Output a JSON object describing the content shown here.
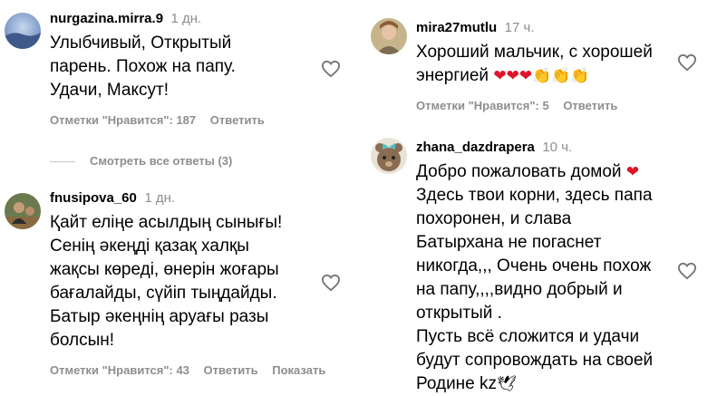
{
  "icons": {
    "like": "heart-outline-icon"
  },
  "left": {
    "c1": {
      "username": "nurgazina.mirra.9",
      "time": "1 дн.",
      "lines": [
        "Улыбчивый, Открытый",
        "парень. Похож на папу.",
        "Удачи, Максут!"
      ],
      "likes": "Отметки \"Нравится\": 187",
      "reply": "Ответить"
    },
    "view_replies": "Смотреть все ответы (3)",
    "c2": {
      "username": "fnusipova_60",
      "time": "1 дн.",
      "lines": [
        "Қайт еліңе асылдың сынығы!",
        "Сенің әкеңді қазақ халқы",
        "жақсы көреді, өнерін жоғары",
        "бағалайды, сүйіп тыңдайды.",
        "Батыр әкеңнің аруағы разы",
        "болсын!"
      ],
      "likes": "Отметки \"Нравится\": 43",
      "reply": "Ответить",
      "translate": "Показать"
    }
  },
  "right": {
    "c1": {
      "username": "mira27mutlu",
      "time": "17 ч.",
      "line1": "Хороший мальчик, с хорошей",
      "line2": "энергией",
      "emojis_hearts": "❤❤❤",
      "emojis_claps": "👏👏👏",
      "likes": "Отметки \"Нравится\": 5",
      "reply": "Ответить"
    },
    "c2": {
      "username": "zhana_dazdrapera",
      "time": "10 ч.",
      "line1": "Добро пожаловать домой",
      "heart": "❤",
      "lines": [
        "Здесь твои корни, здесь папа",
        "похоронен, и слава",
        "Батырхана не погаснет",
        "никогда,,, Очень очень похож",
        "на папу,,,,видно добрый и",
        "открытый .",
        "Пусть всё сложится и удачи",
        "будут сопровождать на своей"
      ],
      "last_line": "Родине kz",
      "dove": "🕊"
    }
  }
}
